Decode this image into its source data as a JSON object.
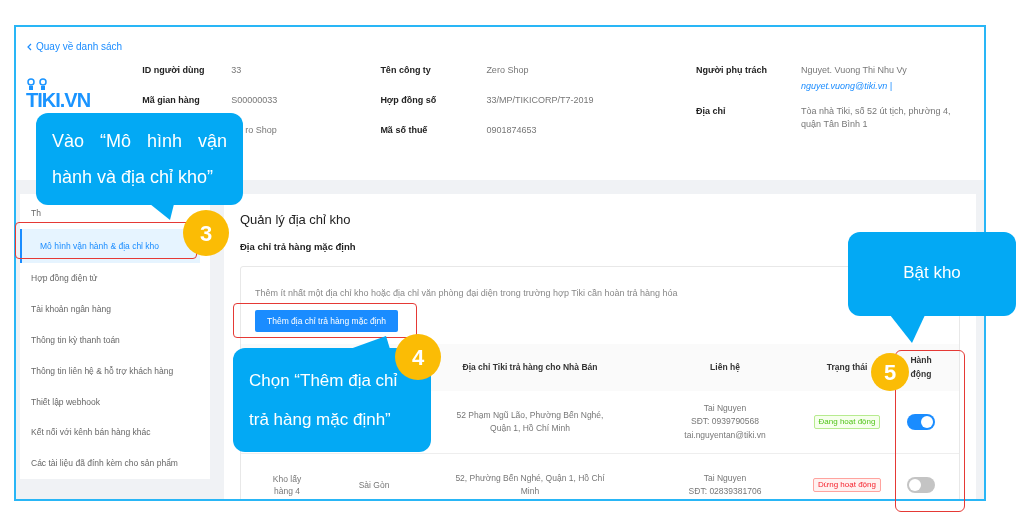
{
  "back_link": "Quay về danh sách",
  "logo": {
    "text": "TIKI.VN"
  },
  "info_columns": [
    [
      {
        "label": "ID người dùng",
        "value": "33"
      },
      {
        "label": "Mã gian hàng",
        "value": "S00000033"
      },
      {
        "value": "ro Shop"
      }
    ],
    [
      {
        "label": "Tên công ty",
        "value": "Zero Shop"
      },
      {
        "label": "Hợp đồng số",
        "value": "33/MP/TIKICORP/T7-2019"
      },
      {
        "label": "Mã số thuế",
        "value": "0901874653"
      }
    ],
    [
      {
        "label": "Người phụ trách",
        "value": "Nguyet. Vuong Thi Nhu Vy",
        "email": "nguyet.vuong@tiki.vn |"
      },
      {
        "label": "Địa chỉ",
        "value": "Tòa nhà Tiki, số 52 út tịch, phường 4, quận Tân Bình 1"
      }
    ]
  ],
  "sidebar": {
    "items": [
      {
        "label": "Th",
        "selected": false
      },
      {
        "label": "Mô hình vận hành & địa chỉ kho",
        "selected": true
      },
      {
        "label": "Hợp đồng điện tử",
        "selected": false
      },
      {
        "label": "Tài khoản ngân hàng",
        "selected": false
      },
      {
        "label": "Thông tin kỳ thanh toán",
        "selected": false
      },
      {
        "label": "Thông tin liên hệ & hỗ trợ khách hàng",
        "selected": false
      },
      {
        "label": "Thiết lập webhook",
        "selected": false
      },
      {
        "label": "Kết nối với kênh bán hàng khác",
        "selected": false
      },
      {
        "label": "Các tài liệu đã đính kèm cho sản phẩm",
        "selected": false
      }
    ]
  },
  "content": {
    "title": "Quản lý địa chỉ kho",
    "subtitle": "Địa chỉ trả hàng mặc định",
    "notice": "Thêm ít nhất một địa chỉ kho hoặc địa chỉ văn phòng đại diện trong trường hợp Tiki cần hoàn trả hàng hóa",
    "add_button": "Thêm địa chỉ trả hàng mặc định"
  },
  "table": {
    "columns": [
      "Địa chỉ Tiki trả hàng cho Nhà Bán",
      "Liên hệ",
      "Trạng thái",
      "Hành động"
    ],
    "rows": [
      {
        "address": "52 Phạm Ngũ Lão, Phường Bến Nghé, Quận 1, Hồ Chí Minh",
        "contact": [
          "Tai Nguyen",
          "SĐT: 0939790568",
          "tai.nguyentan@tiki.vn"
        ],
        "status": "Đang hoạt động",
        "active": true
      },
      {
        "name": "Kho lấy hàng 4",
        "city": "Sài Gòn",
        "address": "52, Phường Bến Nghé, Quận 1, Hồ Chí Minh",
        "contact": [
          "Tai Nguyen",
          "SĐT: 02839381706"
        ],
        "status": "Dừng hoạt động",
        "active": false
      }
    ]
  },
  "callouts": [
    {
      "number": "3",
      "text": "Vào “Mô hình vận hành và địa chỉ kho”"
    },
    {
      "number": "4",
      "text": "Chọn “Thêm địa chỉ trả hàng mặc định”"
    },
    {
      "number": "5",
      "text": "Bật kho"
    }
  ]
}
